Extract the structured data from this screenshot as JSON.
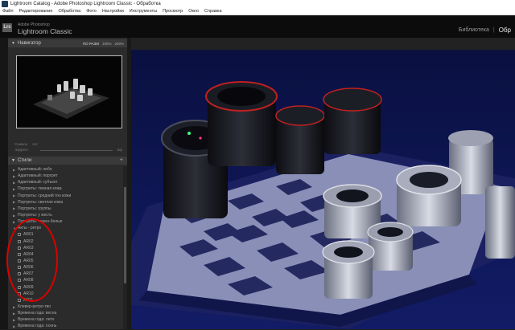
{
  "window": {
    "title": "Lightroom Catalog - Adobe Photoshop Lightroom Classic - Обработка"
  },
  "menu": [
    "Файл",
    "Редактирование",
    "Обработка",
    "Фото",
    "Настройки",
    "Инструменты",
    "Просмотр",
    "Окно",
    "Справка"
  ],
  "identity": {
    "logo": "Lrc",
    "brand_small": "Adobe Photoshop",
    "brand_big": "Lightroom Classic"
  },
  "modules": {
    "library": "Библиотека",
    "separator": "|",
    "develop": "Обр"
  },
  "navigator": {
    "title": "Навигатор",
    "zoom": [
      "ПО РАЗМ",
      "100%",
      "200%"
    ]
  },
  "snapshot_row": {
    "a": "Снимок",
    "b": "Акт"
  },
  "effect_row": {
    "a": "Эффект",
    "b": "Эф"
  },
  "styles": {
    "title": "Стили",
    "add": "+",
    "groups": [
      "Адаптивный: небо",
      "Адаптивный: портрет",
      "Адаптивный: субъект",
      "Портреты: темная кожа",
      "Портреты: средний тон кожи",
      "Портреты: светлая кожа",
      "Портреты: группы",
      "Портреты: у жесть",
      "Портреты: черно-белые"
    ],
    "open_group": "Акты - ретро",
    "subitems": [
      "AR01",
      "AR02",
      "AR03",
      "AR04",
      "AR05",
      "AR06",
      "AR07",
      "AR08",
      "AR09",
      "AR10",
      "AR11"
    ],
    "tail_groups": [
      "Клевер-ретро-тво",
      "Времена года: весна",
      "Времена года: лето",
      "Времена года: осень"
    ]
  }
}
